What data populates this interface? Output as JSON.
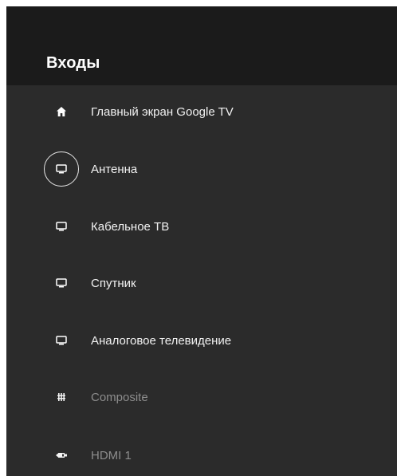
{
  "header": {
    "title": "Входы"
  },
  "items": [
    {
      "label": "Главный экран Google TV",
      "icon": "home-icon",
      "disabled": false
    },
    {
      "label": "Антенна",
      "icon": "tv-icon",
      "disabled": false,
      "focused": true
    },
    {
      "label": "Кабельное ТВ",
      "icon": "tv-icon",
      "disabled": false
    },
    {
      "label": "Спутник",
      "icon": "tv-icon",
      "disabled": false
    },
    {
      "label": "Аналоговое телевидение",
      "icon": "tv-icon",
      "disabled": false
    },
    {
      "label": "Composite",
      "icon": "composite-icon",
      "disabled": true
    },
    {
      "label": "HDMI 1",
      "icon": "hdmi-icon",
      "disabled": true
    }
  ]
}
